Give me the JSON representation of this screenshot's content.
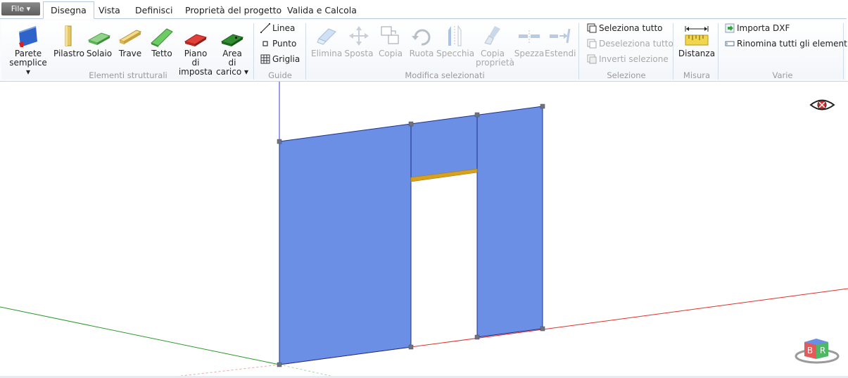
{
  "menu": {
    "file_label": "File ▾"
  },
  "tabs": [
    {
      "label": "Disegna",
      "active": true
    },
    {
      "label": "Vista"
    },
    {
      "label": "Definisci"
    },
    {
      "label": "Proprietà del progetto"
    },
    {
      "label": "Valida e Calcola"
    }
  ],
  "ribbon": {
    "structural": {
      "group_label": "Elementi strutturali",
      "parete": "Parete semplice ▾",
      "pilastro": "Pilastro",
      "solaio": "Solaio",
      "trave": "Trave",
      "tetto": "Tetto",
      "piano": "Piano di imposta",
      "area": "Area di carico ▾"
    },
    "guide": {
      "group_label": "Guide",
      "linea": "Linea",
      "punto": "Punto",
      "griglia": "Griglia"
    },
    "modify": {
      "group_label": "Modifica selezionati",
      "elimina": "Elimina",
      "sposta": "Sposta",
      "copia": "Copia",
      "ruota": "Ruota",
      "specchia": "Specchia",
      "copia_proprieta": "Copia proprietà",
      "spezza": "Spezza",
      "estendi": "Estendi"
    },
    "selection": {
      "group_label": "Selezione",
      "seleziona_tutto": "Seleziona tutto",
      "deseleziona_tutto": "Deseleziona tutto",
      "inverti": "Inverti selezione"
    },
    "measure": {
      "group_label": "Misura",
      "distanza": "Distanza"
    },
    "varie": {
      "group_label": "Varie",
      "importa": "Importa DXF",
      "rinomina": "Rinomina tutti gli elementi"
    }
  },
  "viewport": {
    "wall_color": "#6a8fe4",
    "beam_color": "#d9a11b",
    "axis_x_color": "#e0302a",
    "axis_y_color": "#2a9a2a",
    "axis_z_color": "#3a3ad6",
    "logo_letters": [
      "B",
      "R"
    ]
  }
}
